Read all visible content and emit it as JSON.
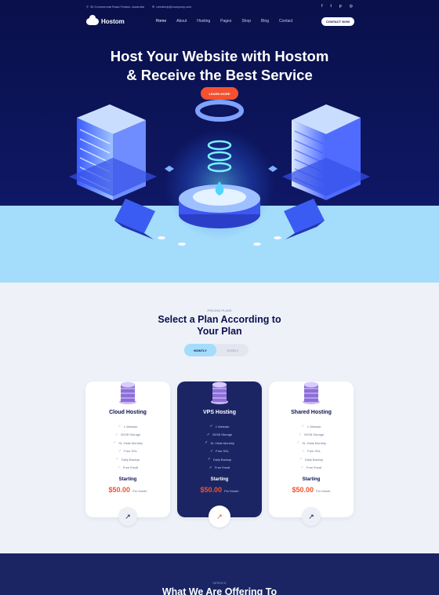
{
  "topbar": {
    "address": "30 Commercial Road Fratton, Australia",
    "email": "needhelp@company.com",
    "social": [
      {
        "icon": "facebook-icon",
        "glyph": "f"
      },
      {
        "icon": "twitter-icon",
        "glyph": "t"
      },
      {
        "icon": "pinterest-icon",
        "glyph": "p"
      },
      {
        "icon": "instagram-icon",
        "glyph": "◎"
      }
    ]
  },
  "nav": {
    "logo": "Hostom",
    "items": [
      "Home",
      "About",
      "Hosting",
      "Pages",
      "Shop",
      "Blog",
      "Contact"
    ],
    "active": "Home",
    "cta": "CONTACT NOW"
  },
  "hero": {
    "title_line1": "Host Your Website with Hostom",
    "title_line2": "& Receive the Best Service",
    "button": "LEARN MORE"
  },
  "pricing": {
    "eyebrow": "PRICING PLANS",
    "title_line1": "Select a Plan According to",
    "title_line2": "Your Plan",
    "toggle": {
      "monthly": "MONTLY",
      "yearly": "YEARLY",
      "selected": "MONTLY"
    },
    "plans": [
      {
        "name": "Cloud Hosting",
        "features": [
          "1 Website",
          "20GB Storage",
          "SL Visits Monthly",
          "Free SSL",
          "Daily Backup",
          "Free Email"
        ],
        "starting": "Starting",
        "price": "$50.00",
        "period": "Per Month",
        "highlighted": false
      },
      {
        "name": "VPS Hosting",
        "features": [
          "1 Website",
          "20GB Storage",
          "SL Visits Monthly",
          "Free SSL",
          "Daily Backup",
          "Free Email"
        ],
        "starting": "Starting",
        "price": "$50.00",
        "period": "Per Month",
        "highlighted": true
      },
      {
        "name": "Shared Hosting",
        "features": [
          "1 Website",
          "20GB Storage",
          "SL Visits Monthly",
          "Free SSL",
          "Daily Backup",
          "Free Email"
        ],
        "starting": "Starting",
        "price": "$50.00",
        "period": "Per Month",
        "highlighted": false
      }
    ]
  },
  "services": {
    "eyebrow": "SERVICE",
    "title": "What We Are Offering To"
  },
  "colors": {
    "navy": "#0b1150",
    "accent": "#f4512f",
    "light_blue": "#a4dcfb",
    "card_dark": "#1b2564"
  }
}
